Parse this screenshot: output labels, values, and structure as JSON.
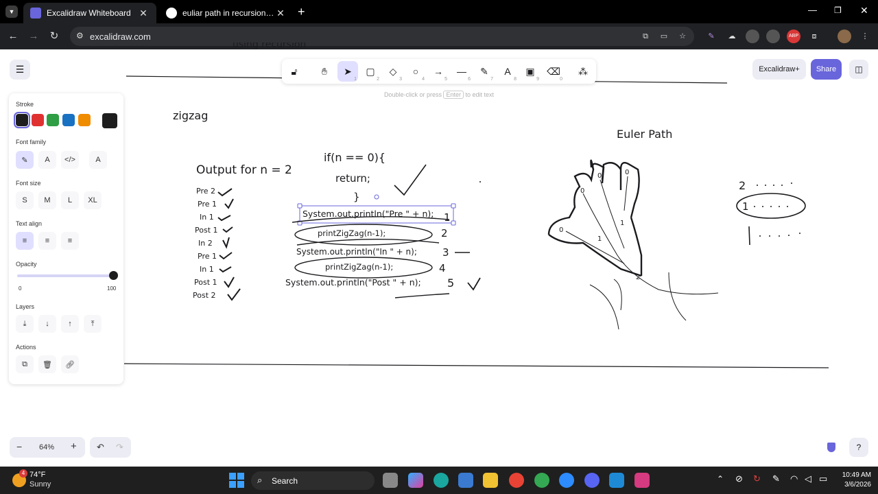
{
  "browser": {
    "tabs": [
      {
        "title": "Excalidraw Whiteboard",
        "active": true
      },
      {
        "title": "euliar path in recursion - Google",
        "active": false
      }
    ],
    "url": "excalidraw.com"
  },
  "excalidraw": {
    "menu_icon": "hamburger-icon",
    "library_button": "Excalidraw+",
    "share_button": "Share",
    "hint": {
      "before": "Double-click or press",
      "key": "Enter",
      "after": "to edit text"
    },
    "tools": [
      {
        "name": "lock",
        "num": ""
      },
      {
        "name": "hand",
        "num": ""
      },
      {
        "name": "selection",
        "num": "1"
      },
      {
        "name": "rectangle",
        "num": "2"
      },
      {
        "name": "diamond",
        "num": "3"
      },
      {
        "name": "ellipse",
        "num": "4"
      },
      {
        "name": "arrow",
        "num": "5"
      },
      {
        "name": "line",
        "num": "6"
      },
      {
        "name": "draw",
        "num": "7"
      },
      {
        "name": "text",
        "num": "8"
      },
      {
        "name": "image",
        "num": "9"
      },
      {
        "name": "eraser",
        "num": "0"
      },
      {
        "name": "extra-tools",
        "num": ""
      }
    ],
    "props": {
      "stroke_label": "Stroke",
      "stroke_colors": [
        "#1e1e1e",
        "#e03131",
        "#2f9e44",
        "#1971c2",
        "#f08c00"
      ],
      "current_stroke": "#1e1e1e",
      "font_family_label": "Font family",
      "font_size_label": "Font size",
      "font_sizes": [
        "S",
        "M",
        "L",
        "XL"
      ],
      "text_align_label": "Text align",
      "opacity_label": "Opacity",
      "opacity_min": "0",
      "opacity_max": "100",
      "opacity_value": 100,
      "layers_label": "Layers",
      "actions_label": "Actions"
    },
    "zoom": "64%"
  },
  "drawing": {
    "top_partial": "using recursion",
    "zigzag": "zigzag",
    "output_title": "Output for n = 2",
    "output_lines": [
      "Pre 2",
      "Pre 1",
      "In 1",
      "Post 1",
      "In 2",
      "Pre 1",
      "In 1",
      "Post 1",
      "Post 2"
    ],
    "code_if": "if(n == 0){",
    "code_return": "return;",
    "code_close": "}",
    "code_pre": "System.out.println(\"Pre \" + n);",
    "code_call1": "printZigZag(n-1);",
    "code_in": "System.out.println(\"In \" + n);",
    "code_call2": "printZigZag(n-1);",
    "code_post": "System.out.println(\"Post \" + n);",
    "nums": [
      "1",
      "2",
      "3",
      "4",
      "5"
    ],
    "euler_title": "Euler Path",
    "tree_labels": [
      "0",
      "0",
      "0",
      "0",
      "1",
      "1",
      "2"
    ],
    "right_nums": [
      "2",
      "1"
    ]
  },
  "taskbar": {
    "weather_temp": "74°F",
    "weather_desc": "Sunny",
    "weather_badge": "4",
    "search": "Search",
    "time": "10:49 AM",
    "date": "3/6/2026"
  }
}
